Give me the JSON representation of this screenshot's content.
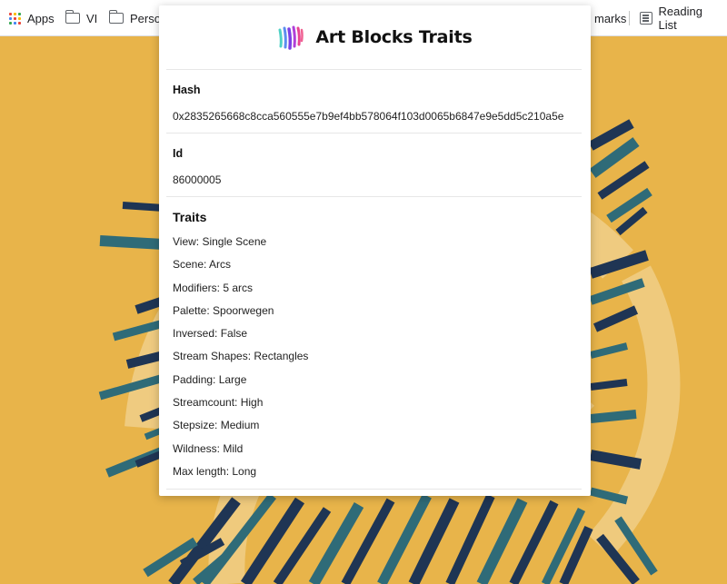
{
  "bookmarks": {
    "apps": "Apps",
    "vi": "VI",
    "personal": "Perso",
    "other": "marks",
    "reading_list": "Reading List"
  },
  "popup": {
    "title": "Art Blocks Traits",
    "hash_label": "Hash",
    "hash_value": "0x2835265668c8cca560555e7b9ef4bb578064f103d0065b6847e9e5dd5c210a5e",
    "id_label": "Id",
    "id_value": "86000005",
    "traits_label": "Traits",
    "traits": [
      "View: Single Scene",
      "Scene: Arcs",
      "Modifiers: 5 arcs",
      "Palette: Spoorwegen",
      "Inversed: False",
      "Stream Shapes: Rectangles",
      "Padding: Large",
      "Streamcount: High",
      "Stepsize: Medium",
      "Wildness: Mild",
      "Max length: Long"
    ]
  },
  "colors": {
    "background": "#e8b44a",
    "stream_dark": "#1f3554",
    "stream_teal": "#2f6b78",
    "arc_light": "#f0cf8a"
  },
  "icons": [
    "apps-grid-icon",
    "folder-icon",
    "reading-list-icon",
    "art-blocks-logo-icon"
  ]
}
